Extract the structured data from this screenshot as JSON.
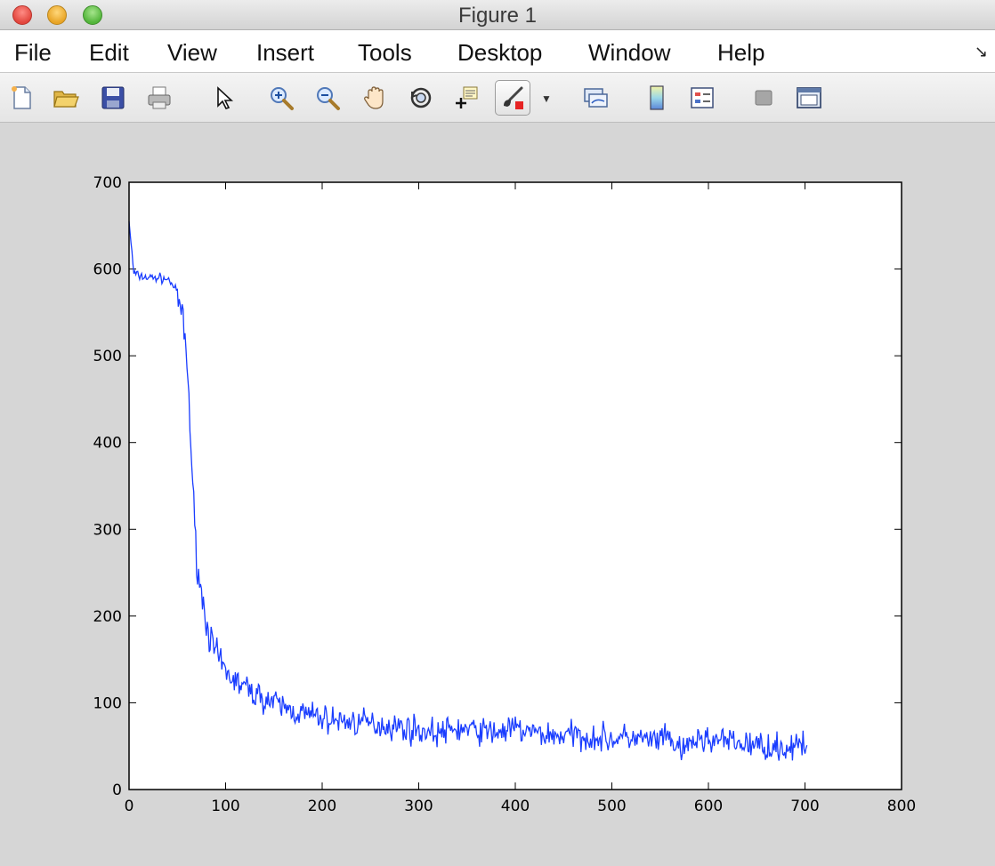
{
  "window": {
    "title": "Figure 1"
  },
  "menu": {
    "items": [
      "File",
      "Edit",
      "View",
      "Insert",
      "Tools",
      "Desktop",
      "Window",
      "Help"
    ]
  },
  "toolbar": {
    "buttons": [
      {
        "name": "new-figure",
        "icon": "new-document-icon"
      },
      {
        "name": "open-file",
        "icon": "folder-open-icon"
      },
      {
        "name": "save-figure",
        "icon": "floppy-disk-icon"
      },
      {
        "name": "print-figure",
        "icon": "printer-icon"
      },
      {
        "name": "edit-plot",
        "icon": "arrow-pointer-icon"
      },
      {
        "name": "zoom-in",
        "icon": "zoom-in-icon"
      },
      {
        "name": "zoom-out",
        "icon": "zoom-out-icon"
      },
      {
        "name": "pan",
        "icon": "hand-icon"
      },
      {
        "name": "rotate-3d",
        "icon": "rotate-3d-icon"
      },
      {
        "name": "data-cursor",
        "icon": "data-cursor-icon"
      },
      {
        "name": "brush",
        "icon": "brush-icon",
        "active": true
      },
      {
        "name": "link-plot",
        "icon": "link-plot-icon"
      },
      {
        "name": "insert-colorbar",
        "icon": "colorbar-icon"
      },
      {
        "name": "insert-legend",
        "icon": "legend-icon"
      },
      {
        "name": "hide-plot-tools",
        "icon": "hide-tools-icon"
      },
      {
        "name": "show-plot-tools",
        "icon": "show-tools-icon"
      }
    ]
  },
  "colors": {
    "line": "#1a3dff",
    "axes_bg": "#ffffff",
    "figure_bg": "#d6d6d6"
  },
  "chart_data": {
    "type": "line",
    "xlim": [
      0,
      800
    ],
    "ylim": [
      0,
      700
    ],
    "xticks": [
      0,
      100,
      200,
      300,
      400,
      500,
      600,
      700,
      800
    ],
    "yticks": [
      0,
      100,
      200,
      300,
      400,
      500,
      600,
      700
    ],
    "grid": false,
    "series": [
      {
        "color": "#1a3dff",
        "x": [
          0,
          2,
          5,
          10,
          20,
          30,
          40,
          45,
          50,
          55,
          58,
          60,
          62,
          64,
          66,
          68,
          70,
          72,
          75,
          80,
          85,
          90,
          95,
          100,
          110,
          120,
          130,
          150,
          170,
          190,
          210,
          230,
          250,
          280,
          300,
          320,
          340,
          360,
          380,
          400,
          420,
          440,
          460,
          480,
          500,
          520,
          540,
          560,
          575,
          580,
          600,
          620,
          640,
          660,
          680,
          700,
          702
        ],
        "y": [
          655,
          630,
          595,
          592,
          590,
          590,
          588,
          583,
          570,
          545,
          520,
          490,
          450,
          400,
          350,
          300,
          270,
          250,
          225,
          195,
          170,
          155,
          145,
          135,
          125,
          118,
          110,
          100,
          90,
          85,
          80,
          78,
          76,
          72,
          68,
          65,
          70,
          68,
          66,
          70,
          65,
          62,
          63,
          60,
          58,
          60,
          56,
          58,
          40,
          55,
          58,
          55,
          52,
          50,
          48,
          50,
          55
        ]
      }
    ]
  }
}
